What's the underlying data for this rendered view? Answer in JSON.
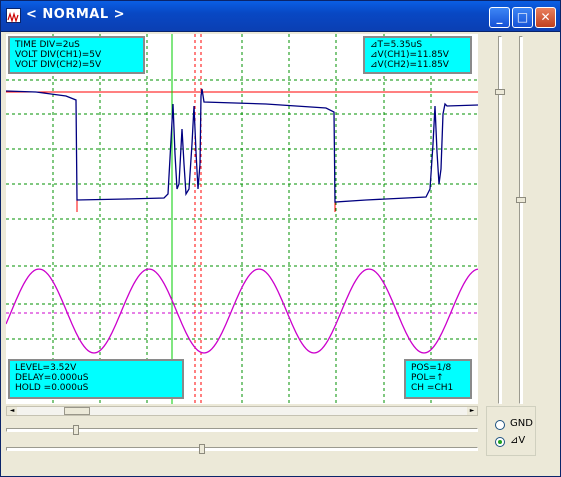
{
  "window": {
    "title": "< NORMAL >"
  },
  "titlebar_buttons": {
    "minimize": "_",
    "maximize": "□",
    "close": "✕"
  },
  "info": {
    "top_left": [
      "TIME DIV=2uS",
      "VOLT DIV(CH1)=5V",
      "VOLT DIV(CH2)=5V"
    ],
    "top_right": [
      "⊿T=5.35uS",
      "⊿V(CH1)=11.85V",
      "⊿V(CH2)=11.85V"
    ],
    "bottom_left": [
      "LEVEL=3.52V",
      "DELAY=0.000uS",
      "HOLD =0.000uS"
    ],
    "bottom_right": [
      "POS=1/8",
      "POL=↑",
      "CH =CH1"
    ]
  },
  "colors": {
    "grid": "#009000",
    "ch1": "#000080",
    "ch2": "#cc00cc",
    "cursor_h": "#ff0000",
    "cursor_v_green": "#00cc00",
    "cursor_v_red": "#ff0000",
    "info_bg": "#00ffff"
  },
  "scrollbar": {
    "left_arrow": "◄",
    "right_arrow": "►"
  },
  "radio_group": {
    "options": [
      {
        "label": "GND",
        "selected": false
      },
      {
        "label": "⊿V",
        "selected": true
      }
    ]
  }
}
